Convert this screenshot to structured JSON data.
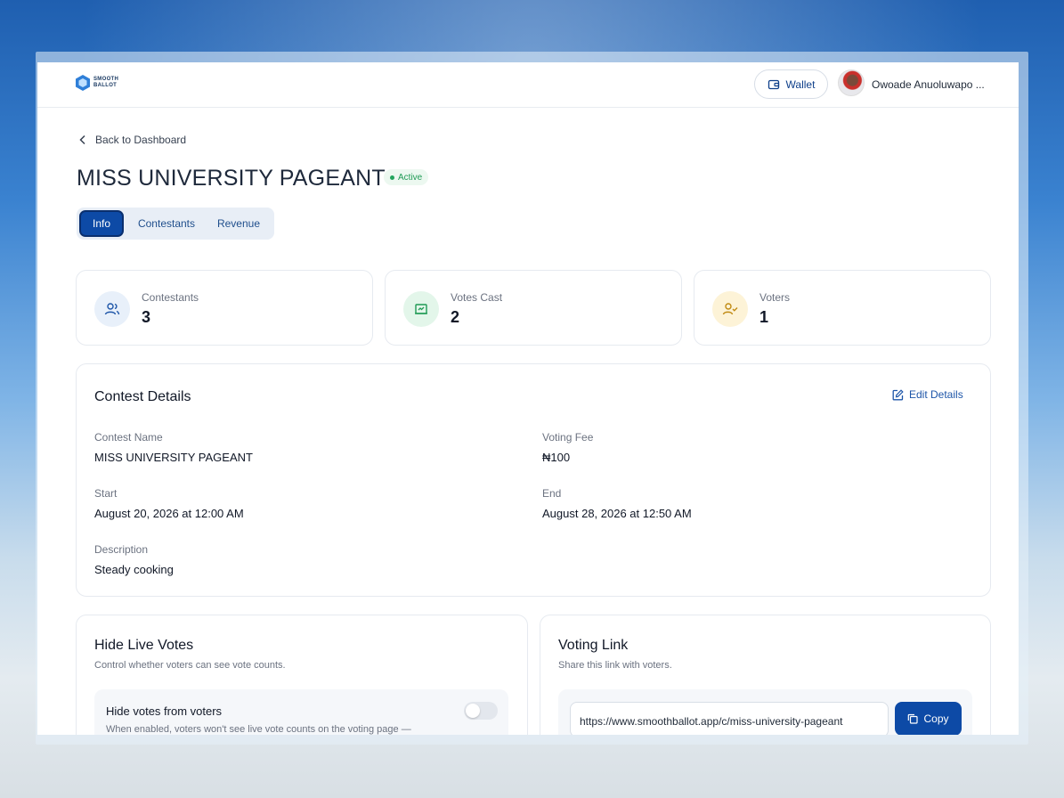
{
  "header": {
    "logo_text": "SMOOTH BALLOT",
    "wallet_label": "Wallet",
    "user_name": "Owoade Anuoluwapo ..."
  },
  "nav": {
    "back_label": "Back to Dashboard"
  },
  "contest": {
    "title": "MISS UNIVERSITY PAGEANT",
    "status": "Active",
    "status_color": "#22a55d"
  },
  "tabs": [
    {
      "label": "Info",
      "active": true
    },
    {
      "label": "Contestants",
      "active": false
    },
    {
      "label": "Revenue",
      "active": false
    }
  ],
  "stats": [
    {
      "label": "Contestants",
      "value": "3",
      "icon": "users-icon",
      "color": "#e8f0fa"
    },
    {
      "label": "Votes Cast",
      "value": "2",
      "icon": "ballot-box-icon",
      "color": "#e3f6ea"
    },
    {
      "label": "Voters",
      "value": "1",
      "icon": "user-check-icon",
      "color": "#fdf3d7"
    }
  ],
  "details": {
    "title": "Contest Details",
    "edit_label": "Edit Details",
    "fields": {
      "contest_name_label": "Contest Name",
      "contest_name_value": "MISS UNIVERSITY PAGEANT",
      "voting_fee_label": "Voting Fee",
      "voting_fee_value": "₦100",
      "start_label": "Start",
      "start_value": "August 20, 2026 at 12:00 AM",
      "end_label": "End",
      "end_value": "August 28, 2026 at 12:50 AM",
      "description_label": "Description",
      "description_value": "Steady cooking"
    }
  },
  "hide_votes": {
    "title": "Hide Live Votes",
    "subtitle": "Control whether voters can see vote counts.",
    "option_title": "Hide votes from voters",
    "option_desc": "When enabled, voters won't see live vote counts on the voting page —",
    "enabled": false
  },
  "voting_link": {
    "title": "Voting Link",
    "subtitle": "Share this link with voters.",
    "url": "https://www.smoothballot.app/c/miss-university-pageant",
    "copy_label": "Copy"
  }
}
